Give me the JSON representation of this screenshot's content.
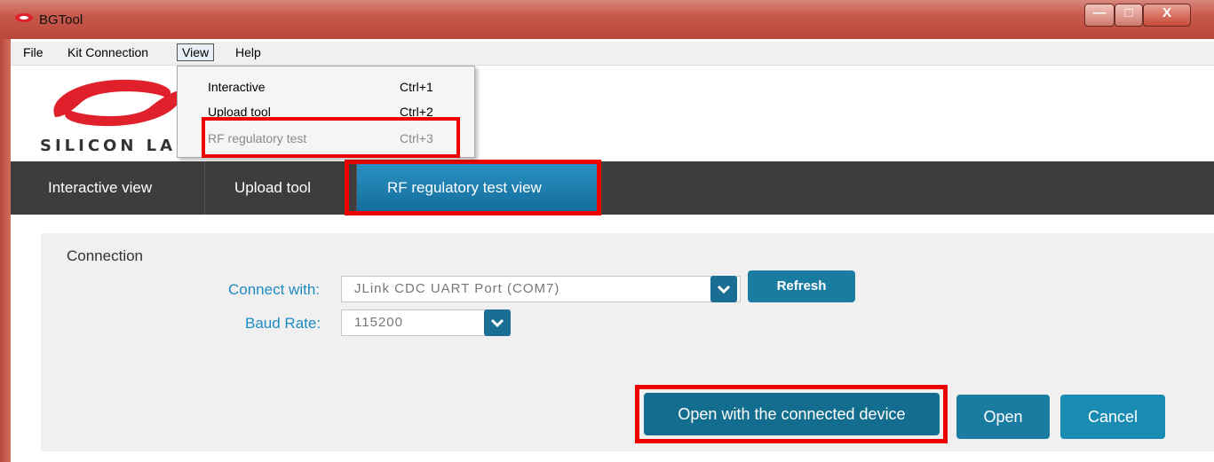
{
  "window": {
    "title": "BGTool",
    "min_glyph": "—",
    "max_glyph": "□",
    "close_glyph": "X"
  },
  "menubar": {
    "items": [
      "File",
      "Kit Connection",
      "View",
      "Help"
    ]
  },
  "logo": {
    "text": "SILICON LAE"
  },
  "view_menu": {
    "items": [
      {
        "label": "Interactive",
        "shortcut": "Ctrl+1",
        "enabled": true
      },
      {
        "label": "Upload tool",
        "shortcut": "Ctrl+2",
        "enabled": true
      },
      {
        "label": "RF regulatory test",
        "shortcut": "Ctrl+3",
        "enabled": false
      }
    ]
  },
  "tabs": [
    {
      "label": "Interactive view",
      "active": false
    },
    {
      "label": "Upload tool",
      "active": false
    },
    {
      "label": "RF regulatory test view",
      "active": true
    }
  ],
  "connection": {
    "title": "Connection",
    "connect_with_label": "Connect with:",
    "connect_with_value": "JLink CDC UART Port (COM7)",
    "refresh_label": "Refresh",
    "baud_rate_label": "Baud Rate:",
    "baud_rate_value": "115200"
  },
  "actions": {
    "open_connected_label": "Open with the connected device",
    "open_label": "Open",
    "cancel_label": "Cancel"
  },
  "colors": {
    "titlebar": "#c75a4c",
    "tabbar": "#3d3d3d",
    "tab_active": "#1e82b4",
    "button": "#1b7ca2",
    "label": "#1f8bc0",
    "highlight": "#ee0000"
  },
  "icons": {
    "app": "silicon-labs-icon",
    "dropdown": "chevron-down-icon"
  }
}
